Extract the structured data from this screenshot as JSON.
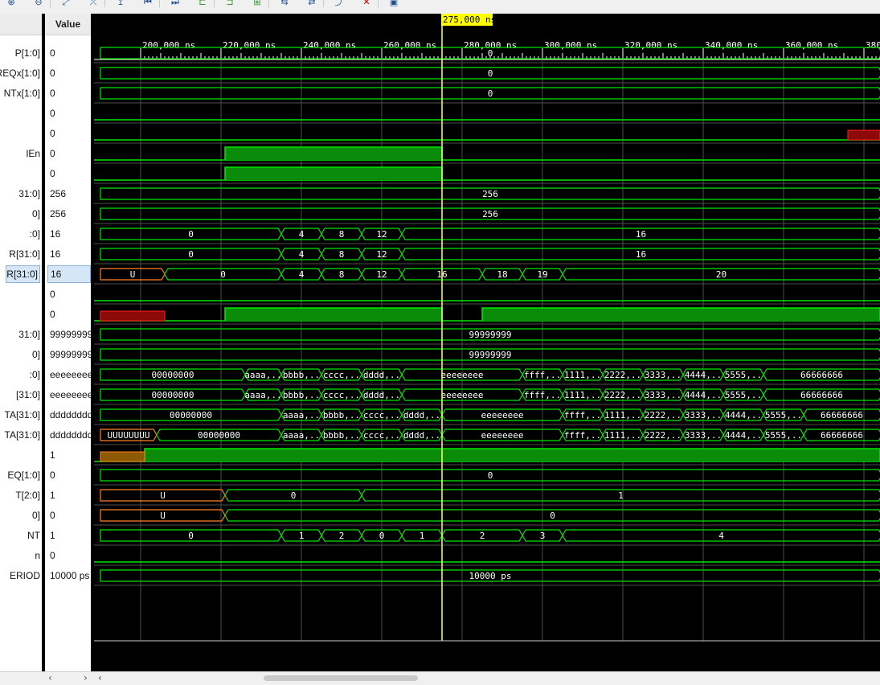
{
  "toolbar": {
    "icons": [
      "zoom-in-icon",
      "zoom-out-icon",
      "zoom-fit-icon",
      "cursor-marker-icon",
      "add-marker-icon",
      "go-first-icon",
      "go-last-icon",
      "prev-transition-icon",
      "next-transition-icon",
      "add-icon",
      "swap-icon",
      "swap2-icon",
      "expand-icon",
      "delete-icon",
      "save-icon"
    ],
    "glyphs": [
      "⊕",
      "⊖",
      "⤢",
      "⤫",
      "↥",
      "⏮",
      "⏭",
      "⊏",
      "⊐",
      "⊞",
      "⇆",
      "⇄",
      "⤴",
      "✕",
      "▣"
    ]
  },
  "columns": {
    "value_header": "Value"
  },
  "cursor": {
    "label": "275,000 ns",
    "time": 275000
  },
  "timeline": {
    "start": 190000,
    "end": 384500,
    "unit": "ns",
    "ticks": [
      {
        "t": 200000,
        "label": "200,000 ns"
      },
      {
        "t": 220000,
        "label": "220,000 ns"
      },
      {
        "t": 240000,
        "label": "240,000 ns"
      },
      {
        "t": 260000,
        "label": "260,000 ns"
      },
      {
        "t": 280000,
        "label": "280,000 ns"
      },
      {
        "t": 300000,
        "label": "300,000 ns"
      },
      {
        "t": 320000,
        "label": "320,000 ns"
      },
      {
        "t": 340000,
        "label": "340,000 ns"
      },
      {
        "t": 360000,
        "label": "360,000 ns"
      },
      {
        "t": 380000,
        "label": "380,000 ns"
      }
    ]
  },
  "signals": [
    {
      "name": "P[1:0]",
      "value": "0",
      "kind": "bus",
      "segs": [
        {
          "from": 190000,
          "to": 384500,
          "text": "0"
        }
      ]
    },
    {
      "name": "REQx[1:0]",
      "value": "0",
      "kind": "bus",
      "segs": [
        {
          "from": 190000,
          "to": 384500,
          "text": "0"
        }
      ]
    },
    {
      "name": "NTx[1:0]",
      "value": "0",
      "kind": "bus",
      "segs": [
        {
          "from": 190000,
          "to": 384500,
          "text": "0"
        }
      ]
    },
    {
      "name": "",
      "value": "0",
      "kind": "bit",
      "highs": [],
      "u": []
    },
    {
      "name": "",
      "value": "0",
      "kind": "bit",
      "highs": [],
      "u": [],
      "x": [
        {
          "from": 376000,
          "to": 384500
        }
      ]
    },
    {
      "name": "lEn",
      "value": "0",
      "kind": "bit",
      "highs": [
        {
          "from": 221000,
          "to": 275000
        }
      ],
      "u": []
    },
    {
      "name": "",
      "value": "0",
      "kind": "bit",
      "highs": [
        {
          "from": 221000,
          "to": 275000
        }
      ],
      "u": []
    },
    {
      "name": "31:0]",
      "value": "256",
      "kind": "bus",
      "segs": [
        {
          "from": 190000,
          "to": 384500,
          "text": "256"
        }
      ]
    },
    {
      "name": "0]",
      "value": "256",
      "kind": "bus",
      "segs": [
        {
          "from": 190000,
          "to": 384500,
          "text": "256"
        }
      ]
    },
    {
      "name": ":0]",
      "value": "16",
      "kind": "bus",
      "segs": [
        {
          "from": 190000,
          "to": 235000,
          "text": "0"
        },
        {
          "from": 235000,
          "to": 245000,
          "text": "4"
        },
        {
          "from": 245000,
          "to": 255000,
          "text": "8"
        },
        {
          "from": 255000,
          "to": 265000,
          "text": "12"
        },
        {
          "from": 265000,
          "to": 384500,
          "text": "16"
        }
      ]
    },
    {
      "name": "R[31:0]",
      "value": "16",
      "kind": "bus",
      "segs": [
        {
          "from": 190000,
          "to": 235000,
          "text": "0"
        },
        {
          "from": 235000,
          "to": 245000,
          "text": "4"
        },
        {
          "from": 245000,
          "to": 255000,
          "text": "8"
        },
        {
          "from": 255000,
          "to": 265000,
          "text": "12"
        },
        {
          "from": 265000,
          "to": 384500,
          "text": "16"
        }
      ]
    },
    {
      "name": "R[31:0]",
      "value": "16",
      "kind": "bus",
      "selected": true,
      "segs": [
        {
          "from": 190000,
          "to": 206000,
          "text": "U",
          "u": true
        },
        {
          "from": 206000,
          "to": 235000,
          "text": "0"
        },
        {
          "from": 235000,
          "to": 245000,
          "text": "4"
        },
        {
          "from": 245000,
          "to": 255000,
          "text": "8"
        },
        {
          "from": 255000,
          "to": 265000,
          "text": "12"
        },
        {
          "from": 265000,
          "to": 285000,
          "text": "16"
        },
        {
          "from": 285000,
          "to": 295000,
          "text": "18"
        },
        {
          "from": 295000,
          "to": 305000,
          "text": "19"
        },
        {
          "from": 305000,
          "to": 384500,
          "text": "20"
        }
      ]
    },
    {
      "name": "",
      "value": "0",
      "kind": "bit",
      "highs": [],
      "u": []
    },
    {
      "name": "",
      "value": "0",
      "kind": "bit",
      "highs": [
        {
          "from": 221000,
          "to": 275000
        },
        {
          "from": 285000,
          "to": 384500
        }
      ],
      "u": [],
      "x": [
        {
          "from": 190000,
          "to": 206000
        }
      ]
    },
    {
      "name": "31:0]",
      "value": "99999999",
      "kind": "bus",
      "segs": [
        {
          "from": 190000,
          "to": 384500,
          "text": "99999999"
        }
      ]
    },
    {
      "name": "0]",
      "value": "99999999",
      "kind": "bus",
      "segs": [
        {
          "from": 190000,
          "to": 384500,
          "text": "99999999"
        }
      ]
    },
    {
      "name": ":0]",
      "value": "eeeeeeee",
      "kind": "bus",
      "segs": [
        {
          "from": 190000,
          "to": 226000,
          "text": "00000000"
        },
        {
          "from": 226000,
          "to": 235000,
          "text": "aaaa,.."
        },
        {
          "from": 235000,
          "to": 245000,
          "text": "bbbb,.."
        },
        {
          "from": 245000,
          "to": 255000,
          "text": "cccc,.."
        },
        {
          "from": 255000,
          "to": 265000,
          "text": "dddd,.."
        },
        {
          "from": 265000,
          "to": 295000,
          "text": "eeeeeeee"
        },
        {
          "from": 295000,
          "to": 305000,
          "text": "ffff,.."
        },
        {
          "from": 305000,
          "to": 315000,
          "text": "1111,.."
        },
        {
          "from": 315000,
          "to": 325000,
          "text": "2222,.."
        },
        {
          "from": 325000,
          "to": 335000,
          "text": "3333,.."
        },
        {
          "from": 335000,
          "to": 345000,
          "text": "4444,.."
        },
        {
          "from": 345000,
          "to": 355000,
          "text": "5555,.."
        },
        {
          "from": 355000,
          "to": 384500,
          "text": "66666666"
        }
      ]
    },
    {
      "name": "[31:0]",
      "value": "eeeeeeee",
      "kind": "bus",
      "segs": [
        {
          "from": 190000,
          "to": 226000,
          "text": "00000000"
        },
        {
          "from": 226000,
          "to": 235000,
          "text": "aaaa,.."
        },
        {
          "from": 235000,
          "to": 245000,
          "text": "bbbb,.."
        },
        {
          "from": 245000,
          "to": 255000,
          "text": "cccc,.."
        },
        {
          "from": 255000,
          "to": 265000,
          "text": "dddd,.."
        },
        {
          "from": 265000,
          "to": 295000,
          "text": "eeeeeeee"
        },
        {
          "from": 295000,
          "to": 305000,
          "text": "ffff,.."
        },
        {
          "from": 305000,
          "to": 315000,
          "text": "1111,.."
        },
        {
          "from": 315000,
          "to": 325000,
          "text": "2222,.."
        },
        {
          "from": 325000,
          "to": 335000,
          "text": "3333,.."
        },
        {
          "from": 335000,
          "to": 345000,
          "text": "4444,.."
        },
        {
          "from": 345000,
          "to": 355000,
          "text": "5555,.."
        },
        {
          "from": 355000,
          "to": 384500,
          "text": "66666666"
        }
      ]
    },
    {
      "name": "TA[31:0]",
      "value": "dddddddd",
      "kind": "bus",
      "segs": [
        {
          "from": 190000,
          "to": 235000,
          "text": "00000000"
        },
        {
          "from": 235000,
          "to": 245000,
          "text": "aaaa,.."
        },
        {
          "from": 245000,
          "to": 255000,
          "text": "bbbb,.."
        },
        {
          "from": 255000,
          "to": 265000,
          "text": "cccc,.."
        },
        {
          "from": 265000,
          "to": 275000,
          "text": "dddd,.."
        },
        {
          "from": 275000,
          "to": 305000,
          "text": "eeeeeeee"
        },
        {
          "from": 305000,
          "to": 315000,
          "text": "ffff,.."
        },
        {
          "from": 315000,
          "to": 325000,
          "text": "1111,.."
        },
        {
          "from": 325000,
          "to": 335000,
          "text": "2222,.."
        },
        {
          "from": 335000,
          "to": 345000,
          "text": "3333,.."
        },
        {
          "from": 345000,
          "to": 355000,
          "text": "4444,.."
        },
        {
          "from": 355000,
          "to": 365000,
          "text": "5555,.."
        },
        {
          "from": 365000,
          "to": 384500,
          "text": "66666666"
        }
      ]
    },
    {
      "name": "TA[31:0]",
      "value": "dddddddd",
      "kind": "bus",
      "segs": [
        {
          "from": 190000,
          "to": 204000,
          "text": "UUUUUUUU",
          "u": true
        },
        {
          "from": 204000,
          "to": 235000,
          "text": "00000000"
        },
        {
          "from": 235000,
          "to": 245000,
          "text": "aaaa,.."
        },
        {
          "from": 245000,
          "to": 255000,
          "text": "bbbb,.."
        },
        {
          "from": 255000,
          "to": 265000,
          "text": "cccc,.."
        },
        {
          "from": 265000,
          "to": 275000,
          "text": "dddd,.."
        },
        {
          "from": 275000,
          "to": 305000,
          "text": "eeeeeeee"
        },
        {
          "from": 305000,
          "to": 315000,
          "text": "ffff,.."
        },
        {
          "from": 315000,
          "to": 325000,
          "text": "1111,.."
        },
        {
          "from": 325000,
          "to": 335000,
          "text": "2222,.."
        },
        {
          "from": 335000,
          "to": 345000,
          "text": "3333,.."
        },
        {
          "from": 345000,
          "to": 355000,
          "text": "4444,.."
        },
        {
          "from": 355000,
          "to": 365000,
          "text": "5555,.."
        },
        {
          "from": 365000,
          "to": 384500,
          "text": "66666666"
        }
      ]
    },
    {
      "name": "",
      "value": "1",
      "kind": "bit",
      "highs": [
        {
          "from": 201000,
          "to": 384500
        }
      ],
      "u": [
        {
          "from": 190000,
          "to": 201000
        }
      ]
    },
    {
      "name": "EQ[1:0]",
      "value": "0",
      "kind": "bus",
      "segs": [
        {
          "from": 190000,
          "to": 384500,
          "text": "0"
        }
      ]
    },
    {
      "name": "T[2:0]",
      "value": "1",
      "kind": "bus",
      "segs": [
        {
          "from": 190000,
          "to": 221000,
          "text": "U",
          "u": true
        },
        {
          "from": 221000,
          "to": 255000,
          "text": "0"
        },
        {
          "from": 255000,
          "to": 384500,
          "text": "1"
        }
      ]
    },
    {
      "name": "0]",
      "value": "0",
      "kind": "bus",
      "segs": [
        {
          "from": 190000,
          "to": 221000,
          "text": "U",
          "u": true
        },
        {
          "from": 221000,
          "to": 384500,
          "text": "0"
        }
      ]
    },
    {
      "name": "NT",
      "value": "1",
      "kind": "bus",
      "segs": [
        {
          "from": 190000,
          "to": 235000,
          "text": "0"
        },
        {
          "from": 235000,
          "to": 245000,
          "text": "1"
        },
        {
          "from": 245000,
          "to": 255000,
          "text": "2"
        },
        {
          "from": 255000,
          "to": 265000,
          "text": "0"
        },
        {
          "from": 265000,
          "to": 275000,
          "text": "1"
        },
        {
          "from": 275000,
          "to": 295000,
          "text": "2"
        },
        {
          "from": 295000,
          "to": 305000,
          "text": "3"
        },
        {
          "from": 305000,
          "to": 384500,
          "text": "4"
        }
      ]
    },
    {
      "name": "n",
      "value": "0",
      "kind": "bit",
      "highs": [],
      "u": []
    },
    {
      "name": "ERIOD",
      "value": "10000 ps",
      "kind": "bus",
      "segs": [
        {
          "from": 190000,
          "to": 384500,
          "text": "10000 ps"
        }
      ]
    }
  ],
  "colors": {
    "wave": "#00e600",
    "wave_fill": "#0a8c0a",
    "undefined": "#ff7f27",
    "undefined_fill": "#8c5a00",
    "x_fill": "#8c0a0a",
    "cursor": "#ffff66",
    "grid": "#4d4d4d",
    "bus_text": "#ffffff"
  }
}
